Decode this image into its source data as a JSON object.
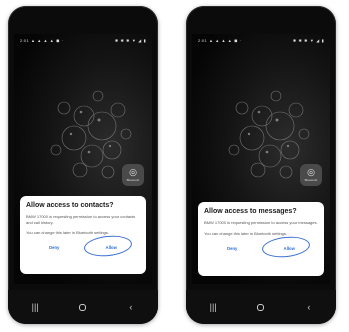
{
  "left_phone": {
    "status_left": [
      "2:01",
      "▲",
      "▲",
      "▲",
      "▲",
      "◼",
      "·"
    ],
    "status_right": [
      "✱",
      "✱",
      "✱",
      "▼",
      "◢",
      "▮"
    ],
    "app_label": "Bluetooth",
    "dialog": {
      "title": "Allow access to contacts?",
      "body": "BMW 17000 is requesting permission to access your contacts and call history.",
      "note": "You can change this later in Bluetooth settings.",
      "deny_label": "Deny",
      "allow_label": "Allow"
    }
  },
  "right_phone": {
    "status_left": [
      "2:01",
      "▲",
      "▲",
      "▲",
      "▲",
      "◼",
      "·"
    ],
    "status_right": [
      "✱",
      "✱",
      "✱",
      "▼",
      "◢",
      "▮"
    ],
    "app_label": "Bluetooth",
    "dialog": {
      "title": "Allow access to messages?",
      "body": "BMW 17000 is requesting permission to access your messages.",
      "note": "You can change this later in Bluetooth settings.",
      "deny_label": "Deny",
      "allow_label": "Allow"
    }
  },
  "nav": {
    "recents": "|||",
    "back": "‹"
  },
  "colors": {
    "accent": "#2f6fd8",
    "annotation_circle": "#3a6fd1",
    "phone_frame": "#0b0b0b"
  }
}
